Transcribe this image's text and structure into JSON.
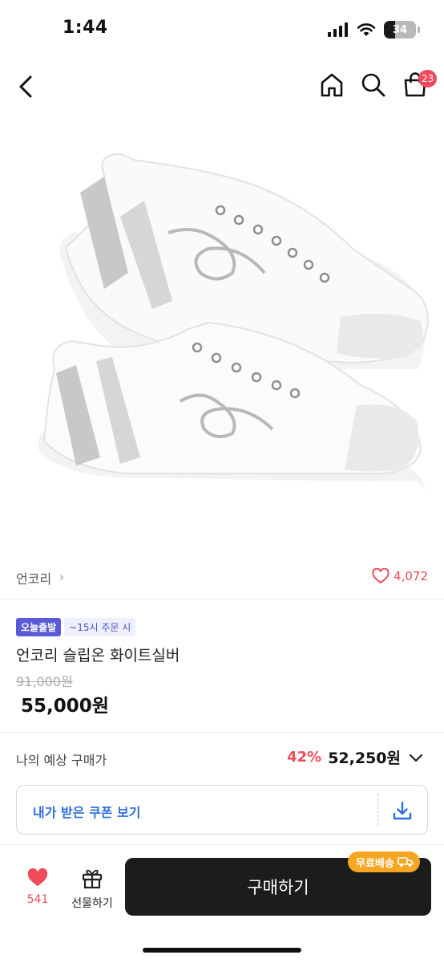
{
  "status_bar": {
    "time": "1:44",
    "battery_level": "34",
    "battery_fraction": 0.34
  },
  "header": {
    "cart_count": "23"
  },
  "product": {
    "brand": "언코리",
    "brand_chevron": "›",
    "like_count": "4,072",
    "badge_today": "오늘출발",
    "badge_time": "~15시 주문 시",
    "name": "언코리 슬립온 화이트실버",
    "original_price": "91,000원",
    "sale_price": "55,000원"
  },
  "expected": {
    "label": "나의 예상 구매가",
    "discount": "42%",
    "price": "52,250원"
  },
  "coupon": {
    "label": "내가 받은 쿠폰 보기"
  },
  "bottom": {
    "wish_count": "541",
    "gift_label": "선물하기",
    "buy_label": "구매하기",
    "shipping_label": "무료배송"
  },
  "colors": {
    "accent_red": "#ef4a5c",
    "badge_purple": "#5a5ad9",
    "coupon_blue": "#2d6ddb",
    "shipping_orange": "#f5a623",
    "buy_button": "#1c1c1c"
  }
}
